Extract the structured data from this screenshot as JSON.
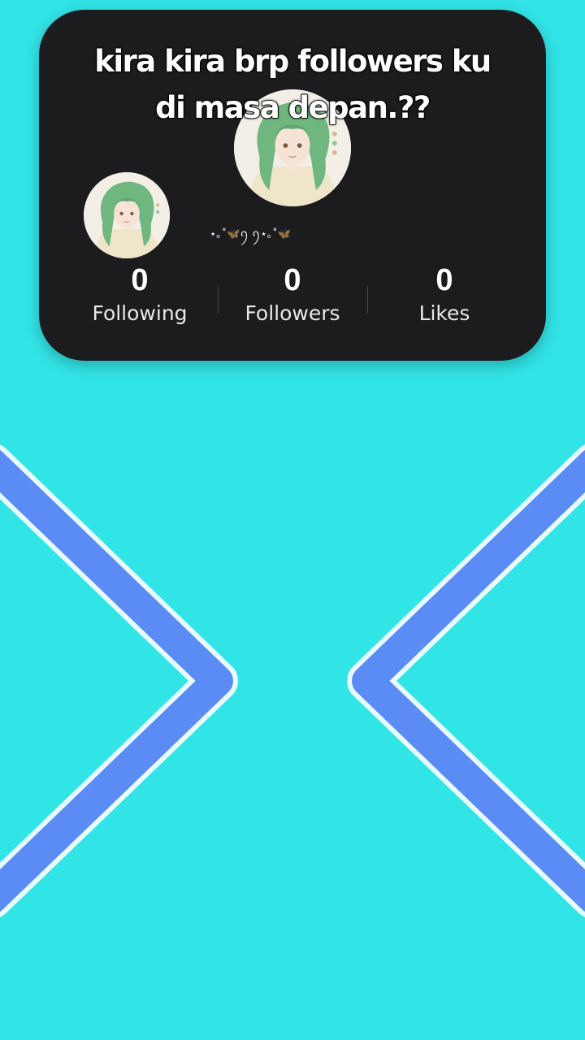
{
  "caption": {
    "line1": "kira kira brp followers ku",
    "line2": "di masa depan.??"
  },
  "profile": {
    "nickname_glyphs": "⋆｡˚🦋ꪆ ꪆ⋆｡˚🦋",
    "avatar_icon": "anime-girl-green-hair-avatar"
  },
  "stats": [
    {
      "value": "0",
      "label": "Following"
    },
    {
      "value": "0",
      "label": "Followers"
    },
    {
      "value": "0",
      "label": "Likes"
    }
  ],
  "colors": {
    "background": "#31e4e6",
    "card": "#1c1c1e",
    "chevron": "#5b8cf5",
    "chevron_outline": "#e8fbff",
    "text": "#ffffff"
  },
  "icons": {
    "left_chevron": "chevron-right-icon",
    "right_chevron": "chevron-left-icon"
  }
}
